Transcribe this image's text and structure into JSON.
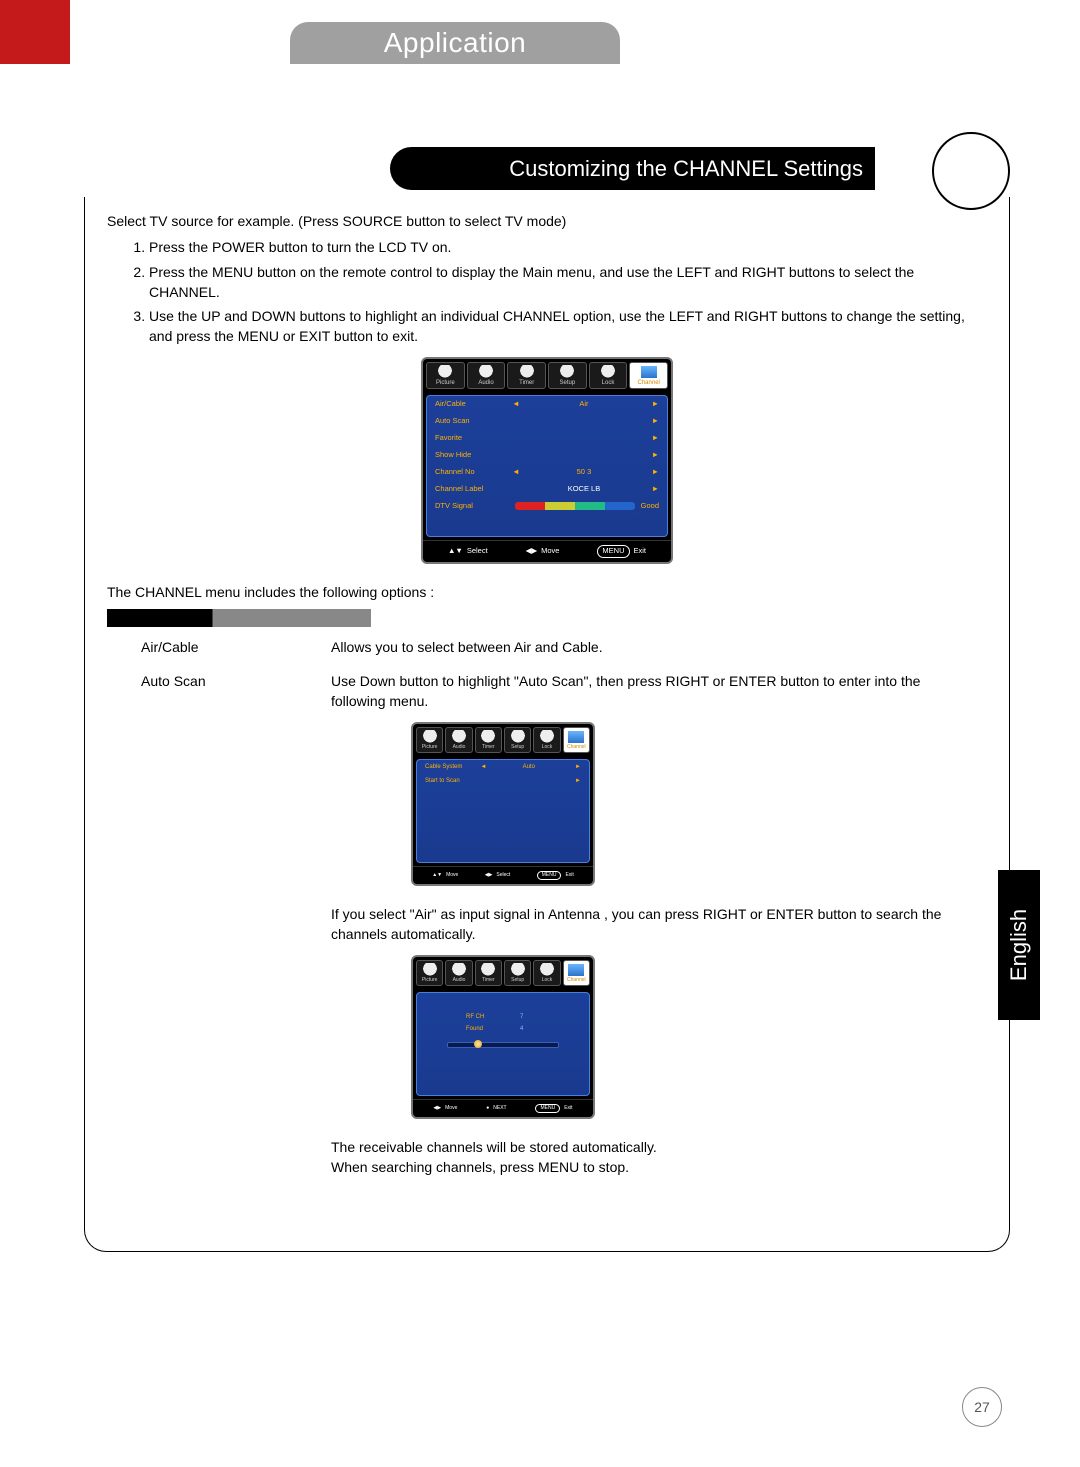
{
  "header": {
    "tab": "Application",
    "section_title": "Customizing the CHANNEL Settings"
  },
  "intro": "Select TV source for example. (Press SOURCE button to select TV mode)",
  "steps": [
    "Press the POWER button to turn the LCD TV on.",
    "Press the MENU button on the remote control to display the Main menu, and use the LEFT and RIGHT buttons to select the CHANNEL.",
    "Use the UP and DOWN buttons to highlight an individual CHANNEL option, use the LEFT and RIGHT buttons to change the setting, and press the MENU or EXIT button to exit."
  ],
  "menu": {
    "tabs": [
      "Picture",
      "Audio",
      "Timer",
      "Setup",
      "Lock",
      "Channel"
    ],
    "rows": {
      "air_cable": {
        "label": "Air/Cable",
        "value": "Air"
      },
      "auto_scan": {
        "label": "Auto Scan"
      },
      "favorite": {
        "label": "Favorite"
      },
      "show_hide": {
        "label": "Show Hide"
      },
      "channel_no": {
        "label": "Channel No",
        "value": "50  3"
      },
      "channel_label": {
        "label": "Channel Label",
        "value": "KOCE LB"
      },
      "dtv_signal": {
        "label": "DTV Signal",
        "good": "Good"
      }
    },
    "footer": {
      "select": "Select",
      "move": "Move",
      "exit": "Exit",
      "menu": "MENU"
    }
  },
  "options_intro": "The CHANNEL menu includes the following options :",
  "options": {
    "air_cable": {
      "label": "Air/Cable",
      "desc": "Allows you to select between Air and Cable."
    },
    "auto_scan": {
      "label": "Auto Scan",
      "desc": "Use Down button to highlight \"Auto Scan\", then press RIGHT or ENTER button to enter into the following menu.",
      "menu": {
        "cable_system": {
          "label": "Cable System",
          "value": "Auto"
        },
        "start_to_scan": {
          "label": "Start to Scan"
        }
      },
      "after_fig_text": "If you select \"Air\" as input signal in Antenna , you can press RIGHT or ENTER button to search the channels automatically.",
      "scan": {
        "rf_label": "RF CH",
        "rf_value": "7",
        "found_label": "Found",
        "found_value": "4",
        "footer_move": "Move",
        "footer_next": "NEXT",
        "footer_exit": "Exit"
      },
      "trailing1": "The receivable channels will be stored automatically.",
      "trailing2": "When searching channels, press MENU to stop."
    }
  },
  "side": {
    "lang": "English"
  },
  "page_number": "27",
  "glyphs": {
    "left": "◄",
    "right": "►",
    "updown": "▲▼",
    "leftright": "◀▶",
    "dot": "●"
  }
}
